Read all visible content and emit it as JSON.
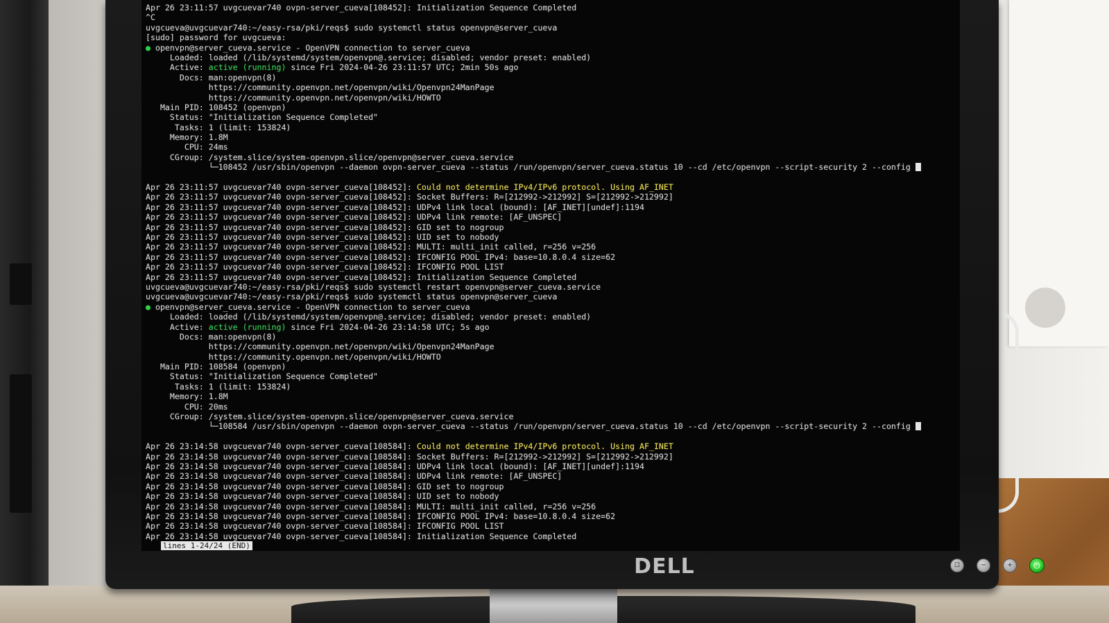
{
  "terminal": {
    "lines": [
      {
        "t": "Apr 26 23:11:57 uvgcuevar740 ovpn-server_cueva[108452]: Initialization Sequence Completed"
      },
      {
        "t": "^C"
      },
      {
        "t": "uvgcueva@uvgcuevar740:~/easy-rsa/pki/reqs$ sudo systemctl status openvpn@server_cueva"
      },
      {
        "t": "[sudo] password for uvgcueva:"
      },
      {
        "dot": "●",
        "t": " openvpn@server_cueva.service - OpenVPN connection to server_cueva"
      },
      {
        "t": "     Loaded: loaded (/lib/systemd/system/openvpn@.service; disabled; vendor preset: enabled)"
      },
      {
        "pre": "     Active: ",
        "green": "active (running)",
        "t": " since Fri 2024-04-26 23:11:57 UTC; 2min 50s ago"
      },
      {
        "t": "       Docs: man:openvpn(8)"
      },
      {
        "t": "             https://community.openvpn.net/openvpn/wiki/Openvpn24ManPage"
      },
      {
        "t": "             https://community.openvpn.net/openvpn/wiki/HOWTO"
      },
      {
        "t": "   Main PID: 108452 (openvpn)"
      },
      {
        "t": "     Status: \"Initialization Sequence Completed\""
      },
      {
        "t": "      Tasks: 1 (limit: 153824)"
      },
      {
        "t": "     Memory: 1.8M"
      },
      {
        "t": "        CPU: 24ms"
      },
      {
        "t": "     CGroup: /system.slice/system-openvpn.slice/openvpn@server_cueva.service"
      },
      {
        "t": "             └─108452 /usr/sbin/openvpn --daemon ovpn-server_cueva --status /run/openvpn/server_cueva.status 10 --cd /etc/openvpn --script-security 2 --config ",
        "cursor": true
      },
      {
        "blank": true
      },
      {
        "pre": "Apr 26 23:11:57 uvgcuevar740 ovpn-server_cueva[108452]: ",
        "yellow": "Could not determine IPv4/IPv6 protocol. Using AF_INET"
      },
      {
        "t": "Apr 26 23:11:57 uvgcuevar740 ovpn-server_cueva[108452]: Socket Buffers: R=[212992->212992] S=[212992->212992]"
      },
      {
        "t": "Apr 26 23:11:57 uvgcuevar740 ovpn-server_cueva[108452]: UDPv4 link local (bound): [AF_INET][undef]:1194"
      },
      {
        "t": "Apr 26 23:11:57 uvgcuevar740 ovpn-server_cueva[108452]: UDPv4 link remote: [AF_UNSPEC]"
      },
      {
        "t": "Apr 26 23:11:57 uvgcuevar740 ovpn-server_cueva[108452]: GID set to nogroup"
      },
      {
        "t": "Apr 26 23:11:57 uvgcuevar740 ovpn-server_cueva[108452]: UID set to nobody"
      },
      {
        "t": "Apr 26 23:11:57 uvgcuevar740 ovpn-server_cueva[108452]: MULTI: multi_init called, r=256 v=256"
      },
      {
        "t": "Apr 26 23:11:57 uvgcuevar740 ovpn-server_cueva[108452]: IFCONFIG POOL IPv4: base=10.8.0.4 size=62"
      },
      {
        "t": "Apr 26 23:11:57 uvgcuevar740 ovpn-server_cueva[108452]: IFCONFIG POOL LIST"
      },
      {
        "t": "Apr 26 23:11:57 uvgcuevar740 ovpn-server_cueva[108452]: Initialization Sequence Completed"
      },
      {
        "t": "uvgcueva@uvgcuevar740:~/easy-rsa/pki/reqs$ sudo systemctl restart openvpn@server_cueva.service"
      },
      {
        "t": "uvgcueva@uvgcuevar740:~/easy-rsa/pki/reqs$ sudo systemctl status openvpn@server_cueva"
      },
      {
        "dot": "●",
        "t": " openvpn@server_cueva.service - OpenVPN connection to server_cueva"
      },
      {
        "t": "     Loaded: loaded (/lib/systemd/system/openvpn@.service; disabled; vendor preset: enabled)"
      },
      {
        "pre": "     Active: ",
        "green": "active (running)",
        "t": " since Fri 2024-04-26 23:14:58 UTC; 5s ago"
      },
      {
        "t": "       Docs: man:openvpn(8)"
      },
      {
        "t": "             https://community.openvpn.net/openvpn/wiki/Openvpn24ManPage"
      },
      {
        "t": "             https://community.openvpn.net/openvpn/wiki/HOWTO"
      },
      {
        "t": "   Main PID: 108584 (openvpn)"
      },
      {
        "t": "     Status: \"Initialization Sequence Completed\""
      },
      {
        "t": "      Tasks: 1 (limit: 153824)"
      },
      {
        "t": "     Memory: 1.8M"
      },
      {
        "t": "        CPU: 20ms"
      },
      {
        "t": "     CGroup: /system.slice/system-openvpn.slice/openvpn@server_cueva.service"
      },
      {
        "t": "             └─108584 /usr/sbin/openvpn --daemon ovpn-server_cueva --status /run/openvpn/server_cueva.status 10 --cd /etc/openvpn --script-security 2 --config ",
        "cursor": true
      },
      {
        "blank": true
      },
      {
        "pre": "Apr 26 23:14:58 uvgcuevar740 ovpn-server_cueva[108584]: ",
        "yellow": "Could not determine IPv4/IPv6 protocol. Using AF_INET"
      },
      {
        "t": "Apr 26 23:14:58 uvgcuevar740 ovpn-server_cueva[108584]: Socket Buffers: R=[212992->212992] S=[212992->212992]"
      },
      {
        "t": "Apr 26 23:14:58 uvgcuevar740 ovpn-server_cueva[108584]: UDPv4 link local (bound): [AF_INET][undef]:1194"
      },
      {
        "t": "Apr 26 23:14:58 uvgcuevar740 ovpn-server_cueva[108584]: UDPv4 link remote: [AF_UNSPEC]"
      },
      {
        "t": "Apr 26 23:14:58 uvgcuevar740 ovpn-server_cueva[108584]: GID set to nogroup"
      },
      {
        "t": "Apr 26 23:14:58 uvgcuevar740 ovpn-server_cueva[108584]: UID set to nobody"
      },
      {
        "t": "Apr 26 23:14:58 uvgcuevar740 ovpn-server_cueva[108584]: MULTI: multi_init called, r=256 v=256"
      },
      {
        "t": "Apr 26 23:14:58 uvgcuevar740 ovpn-server_cueva[108584]: IFCONFIG POOL IPv4: base=10.8.0.4 size=62"
      },
      {
        "t": "Apr 26 23:14:58 uvgcuevar740 ovpn-server_cueva[108584]: IFCONFIG POOL LIST"
      },
      {
        "t": "Apr 26 23:14:58 uvgcuevar740 ovpn-server_cueva[108584]: Initialization Sequence Completed"
      }
    ],
    "pager_status": "lines 1-24/24 (END)"
  },
  "monitor": {
    "brand": "DELL",
    "power_icon": "power-icon",
    "colors": {
      "active": "#2bd24a",
      "warning": "#f2e24a",
      "power_led": "#22c222"
    }
  }
}
